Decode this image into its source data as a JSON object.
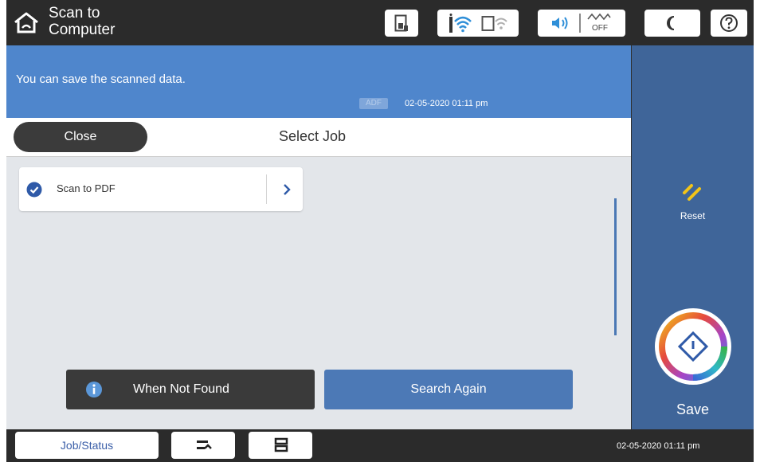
{
  "topbar": {
    "title": "Scan to\nComputer",
    "title_line1": "Scan to",
    "title_line2": "Computer",
    "icons": [
      "home-icon",
      "ink-icon",
      "wifi-icon",
      "wifi-direct-icon",
      "sound-icon",
      "quiet-mode-off-icon",
      "sleep-icon",
      "help-icon"
    ],
    "quiet_off_label": "OFF"
  },
  "banner": {
    "message": "You can save the scanned data.",
    "source_badge": "ADF",
    "datetime": "02-05-2020 01:11 pm"
  },
  "header": {
    "close_label": "Close",
    "title": "Select Job"
  },
  "jobs": [
    {
      "label": "Scan to PDF",
      "selected": true
    }
  ],
  "actions": {
    "not_found_label": "When Not Found",
    "search_again_label": "Search Again"
  },
  "side_panel": {
    "reset_label": "Reset",
    "save_label": "Save"
  },
  "bottombar": {
    "job_status_label": "Job/Status",
    "datetime": "02-05-2020 01:11 pm"
  },
  "colors": {
    "banner": "#4f86cc",
    "side_panel": "#3f6599",
    "search_button": "#4c79b6",
    "bar": "#2b2b2b",
    "reset_accent": "#f2c418"
  }
}
